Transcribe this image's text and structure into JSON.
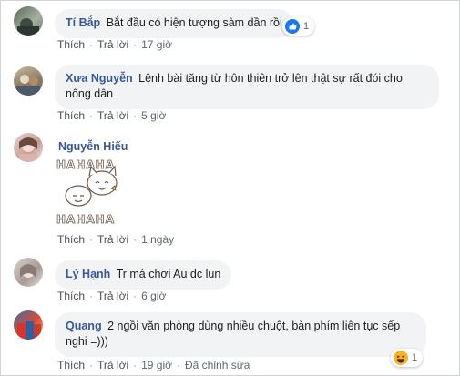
{
  "action_labels": {
    "like": "Thích",
    "reply": "Trả lời",
    "edited": "Đã chỉnh sửa"
  },
  "sticker_text": "HAHAHA",
  "comments": [
    {
      "name": "Tí Bắp",
      "text": "Bắt đầu có hiện tượng sàm dần rồi",
      "time": "17 giờ",
      "reaction": "like-icon",
      "reaction_count": "1"
    },
    {
      "name": "Xưa Nguyễn",
      "text": "Lệnh bài tăng từ hôn thiên trở lên thật sự rất đói cho nông dân",
      "time": "5 giờ"
    },
    {
      "name": "Nguyễn Hiếu",
      "text": "",
      "time": "1 ngày",
      "sticker": "hahaha-cat-sticker"
    },
    {
      "name": "Lý Hạnh",
      "text": "Tr má chơi Au dc lun",
      "time": "6 giờ"
    },
    {
      "name": "Quang",
      "text": "2 ngồi văn phòng dùng nhiều chuột, bàn phím liên tục sếp nghi =)))",
      "time": "19 giờ",
      "edited": true,
      "reaction": "haha-icon",
      "reaction_count": "1"
    }
  ],
  "colors": {
    "name": "#385898",
    "bubble": "#f2f3f5",
    "meta": "#606770",
    "like_blue": "#1877f2",
    "haha_yellow": "#f7b125"
  }
}
